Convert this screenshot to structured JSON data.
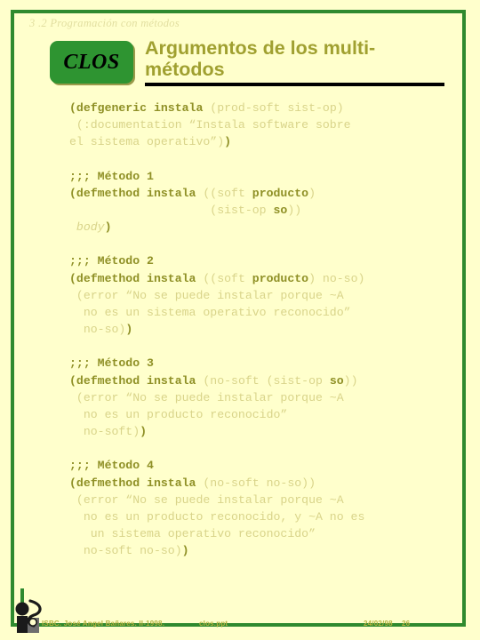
{
  "slide": {
    "section_label": "3 .2 Programación con métodos",
    "badge_label": "CLOS",
    "title": "Argumentos de los multi-métodos",
    "background_color": "#ffffcc",
    "frame_color": "#2f8a2f",
    "title_color": "#a0a030",
    "keyword_color": "#8f9026",
    "body_color": "#d9d48a"
  },
  "code": {
    "blocks": [
      {
        "id": "defgeneric",
        "lines": [
          [
            {
              "t": "(defgeneric instala ",
              "s": "kw"
            },
            {
              "t": "(prod-soft sist-op)",
              "s": "plain"
            }
          ],
          [
            {
              "t": " (:documentation “Instala software sobre",
              "s": "plain"
            }
          ],
          [
            {
              "t": "el sistema operativo”)",
              "s": "plain"
            },
            {
              "t": ")",
              "s": "kw"
            }
          ]
        ]
      },
      {
        "id": "metodo-1",
        "lines": [
          [
            {
              "t": ";;; Método 1",
              "s": "cm"
            }
          ],
          [
            {
              "t": "(defmethod instala ",
              "s": "kw"
            },
            {
              "t": "((soft ",
              "s": "plain"
            },
            {
              "t": "producto",
              "s": "kw"
            },
            {
              "t": ")",
              "s": "plain"
            }
          ],
          [
            {
              "t": "                    (sist-op ",
              "s": "plain"
            },
            {
              "t": "so",
              "s": "kw"
            },
            {
              "t": "))",
              "s": "plain"
            }
          ],
          [
            {
              "t": " body",
              "s": "it"
            },
            {
              "t": ")",
              "s": "kw"
            }
          ]
        ]
      },
      {
        "id": "metodo-2",
        "lines": [
          [
            {
              "t": ";;; Método 2",
              "s": "cm"
            }
          ],
          [
            {
              "t": "(defmethod instala ",
              "s": "kw"
            },
            {
              "t": "((soft ",
              "s": "plain"
            },
            {
              "t": "producto",
              "s": "kw"
            },
            {
              "t": ") no-so)",
              "s": "plain"
            }
          ],
          [
            {
              "t": " (error “No se puede instalar porque ~A",
              "s": "plain"
            }
          ],
          [
            {
              "t": "  no es un sistema operativo reconocido”",
              "s": "plain"
            }
          ],
          [
            {
              "t": "  no-so)",
              "s": "plain"
            },
            {
              "t": ")",
              "s": "kw"
            }
          ]
        ]
      },
      {
        "id": "metodo-3",
        "lines": [
          [
            {
              "t": ";;; Método 3",
              "s": "cm"
            }
          ],
          [
            {
              "t": "(defmethod instala ",
              "s": "kw"
            },
            {
              "t": "(no-soft (sist-op ",
              "s": "plain"
            },
            {
              "t": "so",
              "s": "kw"
            },
            {
              "t": "))",
              "s": "plain"
            }
          ],
          [
            {
              "t": " (error “No se puede instalar porque ~A",
              "s": "plain"
            }
          ],
          [
            {
              "t": "  no es un producto reconocido”",
              "s": "plain"
            }
          ],
          [
            {
              "t": "  no-soft)",
              "s": "plain"
            },
            {
              "t": ")",
              "s": "kw"
            }
          ]
        ]
      },
      {
        "id": "metodo-4",
        "lines": [
          [
            {
              "t": ";;; Método 4",
              "s": "cm"
            }
          ],
          [
            {
              "t": "(defmethod instala ",
              "s": "kw"
            },
            {
              "t": "(no-soft no-so))",
              "s": "plain"
            }
          ],
          [
            {
              "t": " (error “No se puede instalar porque ~A",
              "s": "plain"
            }
          ],
          [
            {
              "t": "  no es un producto reconocido, y ~A no es",
              "s": "plain"
            }
          ],
          [
            {
              "t": "   un sistema operativo reconocido”",
              "s": "plain"
            }
          ],
          [
            {
              "t": "  no-soft no-so)",
              "s": "plain"
            },
            {
              "t": ")",
              "s": "kw"
            }
          ]
        ]
      }
    ]
  },
  "footer": {
    "author": "ISBC. José Angel Bañares. II-1998.",
    "file": "clos.ppt",
    "date": "24/02/98",
    "page": "26",
    "logo_name": "person-figure-logo"
  }
}
